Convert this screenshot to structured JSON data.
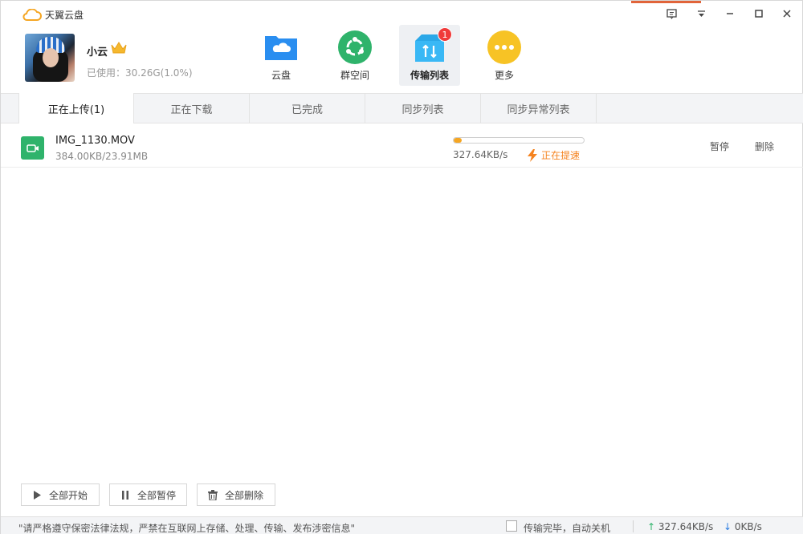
{
  "app": {
    "title": "天翼云盘"
  },
  "colors": {
    "accent_orange": "#f5a623",
    "brand_blue": "#2a8ef0",
    "green": "#2fb36b",
    "badge_red": "#f03a3a"
  },
  "user": {
    "name": "小云",
    "usage": "已使用：30.26G(1.0%)"
  },
  "nav": [
    {
      "label": "云盘",
      "icon": "cloud-folder-icon"
    },
    {
      "label": "群空间",
      "icon": "group-space-icon"
    },
    {
      "label": "传输列表",
      "icon": "transfer-list-icon",
      "badge": "1",
      "active": true
    },
    {
      "label": "更多",
      "icon": "more-icon"
    }
  ],
  "tabs": [
    {
      "label": "正在上传(1)",
      "active": true
    },
    {
      "label": "正在下载"
    },
    {
      "label": "已完成"
    },
    {
      "label": "同步列表"
    },
    {
      "label": "同步异常列表"
    }
  ],
  "transfer": {
    "file_name": "IMG_1130.MOV",
    "size": "384.00KB/23.91MB",
    "progress": 0.0157,
    "speed": "327.64KB/s",
    "accel_text": "正在提速",
    "pause_label": "暂停",
    "delete_label": "删除"
  },
  "actions": {
    "start_all": "全部开始",
    "pause_all": "全部暂停",
    "delete_all": "全部删除"
  },
  "status": {
    "notice": "\"请严格遵守保密法律法规，严禁在互联网上存储、处理、传输、发布涉密信息\"",
    "shutdown_label": "传输完毕，自动关机",
    "upload_speed": "327.64KB/s",
    "download_speed": "0KB/s"
  }
}
